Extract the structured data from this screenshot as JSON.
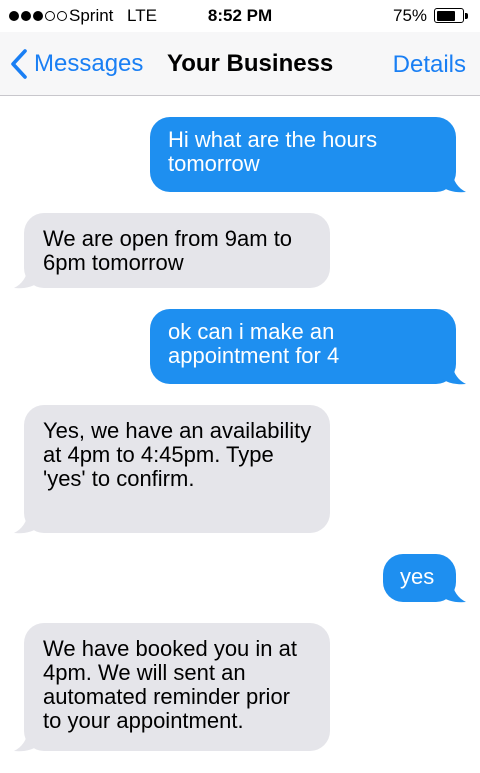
{
  "status_bar": {
    "carrier": "Sprint",
    "network": "LTE",
    "time": "8:52 PM",
    "battery_percent": "75%",
    "battery_level": 0.75,
    "signal_bars_filled": 3,
    "signal_bars_total": 5
  },
  "nav": {
    "back_label": "Messages",
    "title": "Your Business",
    "details_label": "Details"
  },
  "colors": {
    "sent_bubble": "#1e8ff0",
    "received_bubble": "#e5e5ea",
    "accent": "#1a7ff4"
  },
  "messages": [
    {
      "direction": "sent",
      "text": "Hi what are the hours tomorrow"
    },
    {
      "direction": "received",
      "text": "We are open from 9am to 6pm tomorrow"
    },
    {
      "direction": "sent",
      "text": "ok can i make an appointment for 4"
    },
    {
      "direction": "received",
      "text": "Yes, we have an availability at 4pm to 4:45pm. Type 'yes' to confirm."
    },
    {
      "direction": "sent",
      "text": "yes"
    },
    {
      "direction": "received",
      "text": "We have booked you in at 4pm. We will sent an automated reminder prior to your appointment."
    }
  ]
}
